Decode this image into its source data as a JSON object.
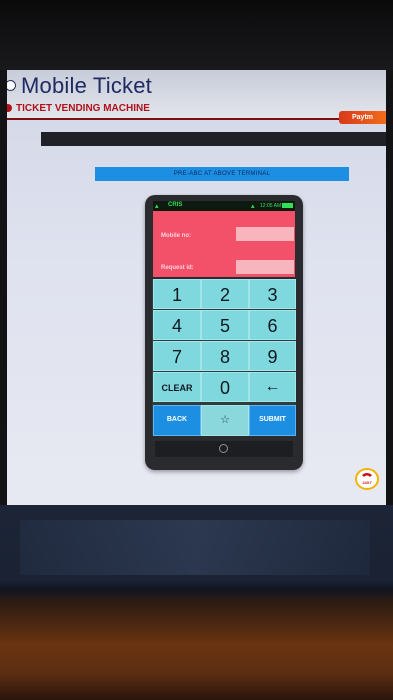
{
  "header": {
    "title": "Mobile Ticket",
    "subtitle": "TICKET VENDING MACHINE",
    "brand_badge": "Paytm"
  },
  "banner": {
    "text": "PRE-ABC AT ABOVE TERMINAL"
  },
  "phone": {
    "status": {
      "app_name": "CRIS",
      "time": "12:05 AM"
    },
    "form": {
      "mobile_label": "Mobile no:",
      "mobile_value": "",
      "request_label": "Request id:",
      "request_value": ""
    },
    "keys": {
      "k1": "1",
      "k2": "2",
      "k3": "3",
      "k4": "4",
      "k5": "5",
      "k6": "6",
      "k7": "7",
      "k8": "8",
      "k9": "9",
      "clear": "CLEAR",
      "k0": "0",
      "backspace": "←",
      "back": "BACK",
      "star": "☆",
      "submit": "SUBMIT"
    }
  },
  "helpline": {
    "text": "24X7"
  },
  "colors": {
    "accent_blue": "#1d8fe3",
    "key_teal": "#7fd8de",
    "form_pink": "#f3506a",
    "header_red": "#b0111a",
    "title_navy": "#1f2a63"
  }
}
